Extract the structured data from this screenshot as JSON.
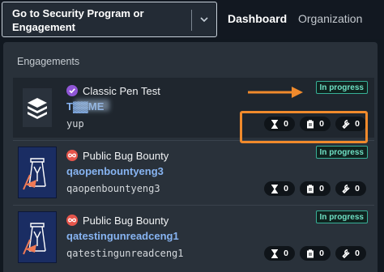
{
  "selector": {
    "label": "Go to Security Program or Engagement"
  },
  "nav": {
    "dashboard": "Dashboard",
    "organization": "Organization"
  },
  "panel": {
    "heading": "Engagements"
  },
  "engagements": [
    {
      "type": "Classic Pen Test",
      "name": "T▓▓ME",
      "slug": "yup",
      "status": "In progress",
      "hourglass": "0",
      "clipboard": "0",
      "wrench": "0",
      "thumb_icon": "layers-icon",
      "type_icon": "check-badge-icon"
    },
    {
      "type": "Public Bug Bounty",
      "name": "qaopenbountyeng3",
      "slug": "qaopenbountyeng3",
      "status": "In progress",
      "hourglass": "0",
      "clipboard": "0",
      "wrench": "0",
      "thumb_icon": "bounty-flag-icon",
      "type_icon": "infinity-icon"
    },
    {
      "type": "Public Bug Bounty",
      "name": "qatestingunreadceng1",
      "slug": "qatestingunreadceng1",
      "status": "In progress",
      "hourglass": "0",
      "clipboard": "0",
      "wrench": "0",
      "thumb_icon": "bounty-flag-icon",
      "type_icon": "infinity-icon"
    }
  ],
  "colors": {
    "status_border": "#37b097",
    "status_text": "#6fe0c4",
    "link": "#87b4f2",
    "annotation": "#f08a2c"
  }
}
